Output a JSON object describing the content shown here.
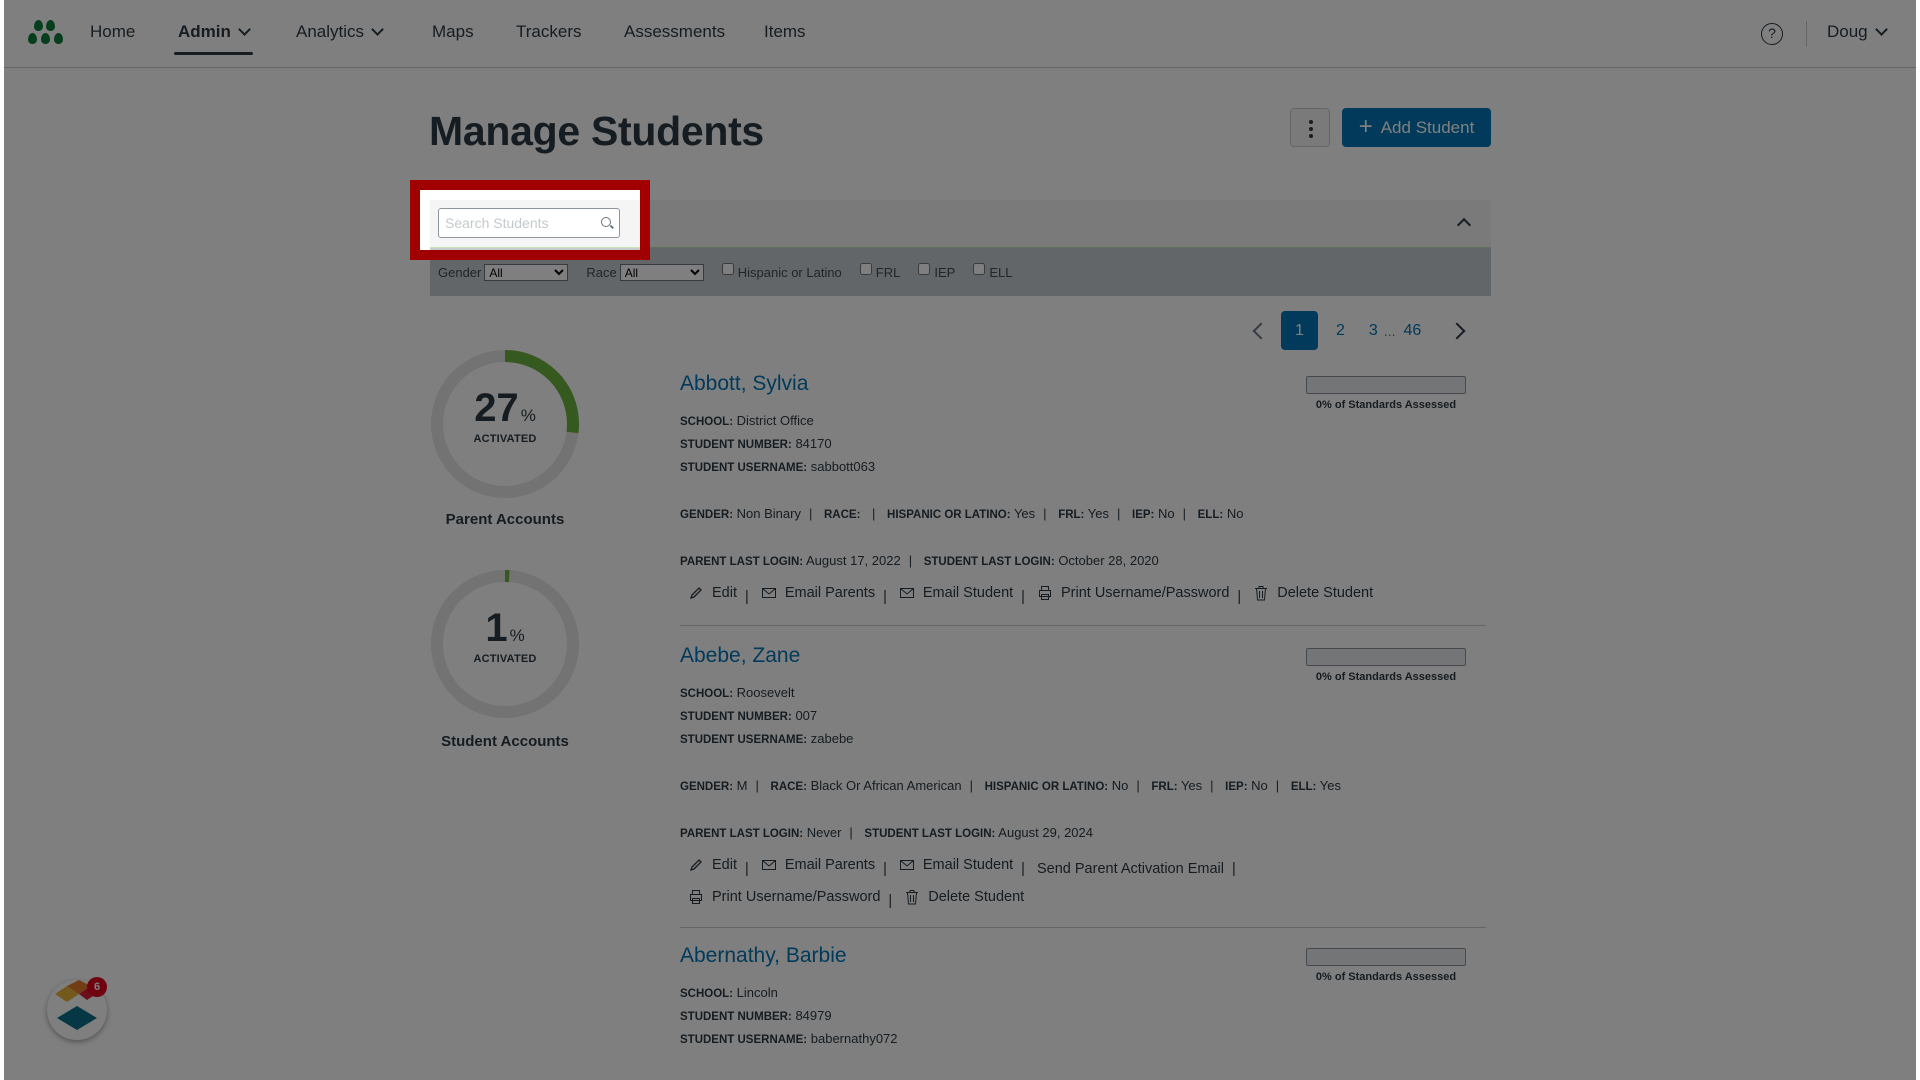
{
  "nav": {
    "items": [
      {
        "label": "Home",
        "dropdown": false,
        "active": false
      },
      {
        "label": "Admin",
        "dropdown": true,
        "active": true
      },
      {
        "label": "Analytics",
        "dropdown": true,
        "active": false
      },
      {
        "label": "Maps",
        "dropdown": false,
        "active": false
      },
      {
        "label": "Trackers",
        "dropdown": false,
        "active": false
      },
      {
        "label": "Assessments",
        "dropdown": false,
        "active": false
      },
      {
        "label": "Items",
        "dropdown": false,
        "active": false
      }
    ],
    "help_icon": "question-circle-icon",
    "help_glyph": "?",
    "user_name": "Doug"
  },
  "page": {
    "title": "Manage Students",
    "add_button_label": "Add Student",
    "add_button_icon": "+",
    "accent_color": "#0374b5"
  },
  "filters": {
    "search_placeholder": "Search Students",
    "search_value": "",
    "gender_label": "Gender",
    "gender_value": "All",
    "race_label": "Race",
    "race_value": "All",
    "checkboxes": [
      {
        "label": "Hispanic or Latino",
        "checked": false
      },
      {
        "label": "FRL",
        "checked": false
      },
      {
        "label": "IEP",
        "checked": false
      },
      {
        "label": "ELL",
        "checked": false
      }
    ]
  },
  "pagination": {
    "pages": [
      "1",
      "2",
      "3"
    ],
    "ellipsis": "...",
    "last_page": "46",
    "current": "1"
  },
  "stats": [
    {
      "percent": 27,
      "value_text": "27",
      "pct_symbol": "%",
      "sub": "ACTIVATED",
      "label": "Parent Accounts"
    },
    {
      "percent": 1,
      "value_text": "1",
      "pct_symbol": "%",
      "sub": "ACTIVATED",
      "label": "Student Accounts"
    }
  ],
  "labels": {
    "school": "SCHOOL:",
    "student_number": "STUDENT NUMBER:",
    "student_username": "STUDENT USERNAME:",
    "gender": "GENDER:",
    "race": "RACE:",
    "hispanic": "HISPANIC OR LATINO:",
    "frl": "FRL:",
    "iep": "IEP:",
    "ell": "ELL:",
    "parent_last_login": "PARENT LAST LOGIN:",
    "student_last_login": "STUDENT LAST LOGIN:",
    "edit": "Edit",
    "email_parents": "Email Parents",
    "email_student": "Email Student",
    "send_activation": "Send Parent Activation Email",
    "print": "Print Username/Password",
    "delete": "Delete Student",
    "standards_suffix": "of Standards Assessed"
  },
  "students": [
    {
      "name": "Abbott, Sylvia",
      "school": "District Office",
      "student_number": "84170",
      "username": "sabbott063",
      "gender": "Non Binary",
      "race": "",
      "hispanic": "Yes",
      "frl": "Yes",
      "iep": "No",
      "ell": "No",
      "parent_last_login": "August 17, 2022",
      "student_last_login": "October 28, 2020",
      "standards_assessed_percent": 0,
      "standards_text": "0% of Standards Assessed"
    },
    {
      "name": "Abebe, Zane",
      "school": "Roosevelt",
      "student_number": "007",
      "username": "zabebe",
      "gender": "M",
      "race": "Black Or African American",
      "hispanic": "No",
      "frl": "Yes",
      "iep": "No",
      "ell": "Yes",
      "parent_last_login": "Never",
      "student_last_login": "August 29, 2024",
      "standards_assessed_percent": 0,
      "standards_text": "0% of Standards Assessed"
    },
    {
      "name": "Abernathy, Barbie",
      "school": "Lincoln",
      "student_number": "84979",
      "username": "babernathy072",
      "standards_assessed_percent": 0,
      "standards_text": "0% of Standards Assessed"
    }
  ],
  "widget": {
    "badge_count": "6"
  },
  "colors": {
    "donut_fill": "#6cb33f",
    "donut_track": "#e6e6e6",
    "highlight": "#a10000"
  }
}
